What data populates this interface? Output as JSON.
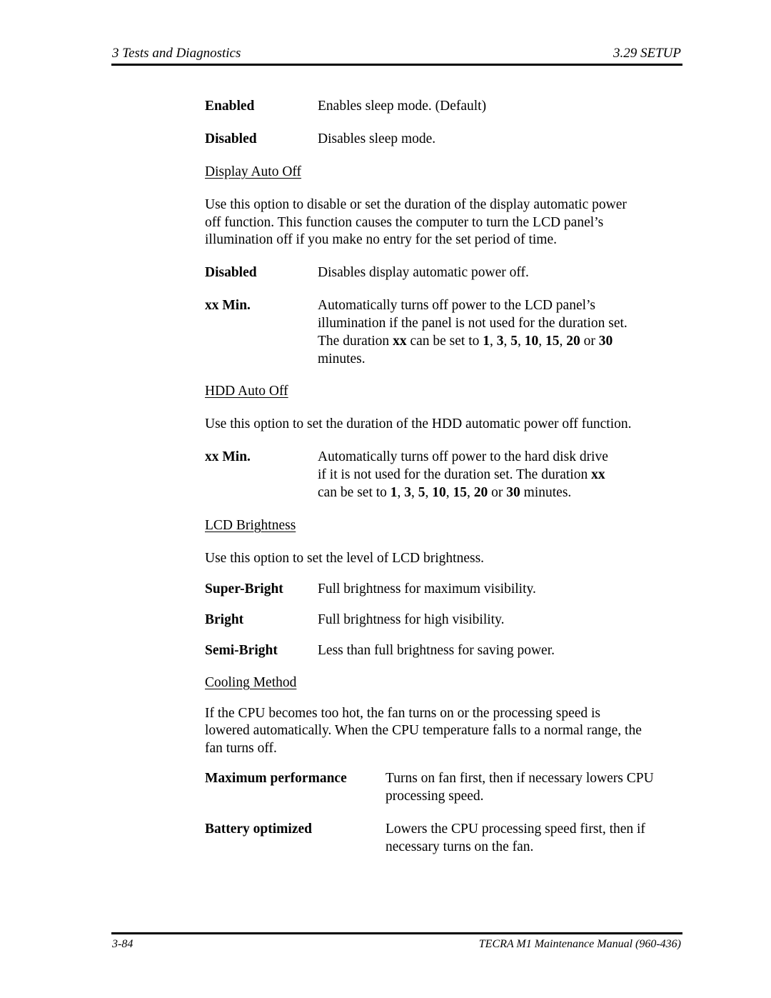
{
  "header": {
    "left": "3  Tests and Diagnostics",
    "right": "3.29  SETUP"
  },
  "sleep_options": [
    {
      "term": "Enabled",
      "desc": "Enables sleep mode. (Default)"
    },
    {
      "term": "Disabled",
      "desc": "Disables sleep mode."
    }
  ],
  "display_auto_off": {
    "heading": "Display Auto Off",
    "intro": [
      "Use this option to disable or set the duration of the display automatic power",
      "off function. This function causes the computer to turn the LCD panel’s",
      "illumination off if you make no entry for the set period of time."
    ],
    "disabled": {
      "term": "Disabled",
      "desc": "Disables display automatic power off."
    },
    "xxmin": {
      "term": "xx Min.",
      "lines": [
        "Automatically turns off power to the LCD panel’s",
        "illumination if the panel is not used for the duration set."
      ],
      "line3_prefix": "The duration ",
      "xx": "xx",
      "line3_mid": " can be set to ",
      "values": [
        "1",
        "3",
        "5",
        "10",
        "15",
        "20",
        "30"
      ],
      "or": " or ",
      "line4": "minutes."
    }
  },
  "hdd_auto_off": {
    "heading": "HDD Auto Off",
    "intro": "Use this option to set the duration of the HDD automatic power off function.",
    "xxmin": {
      "term": "xx Min.",
      "line1": "Automatically turns off power to the hard disk drive",
      "line2_prefix": "if it is not used for the duration set. The duration ",
      "xx": "xx",
      "line3_prefix": "can be set to ",
      "values": [
        "1",
        "3",
        "5",
        "10",
        "15",
        "20",
        "30"
      ],
      "or": " or ",
      "suffix": " minutes."
    }
  },
  "lcd_brightness": {
    "heading": "LCD Brightness",
    "intro": "Use this option to set the level of LCD brightness.",
    "options": [
      {
        "term": "Super-Bright",
        "desc": "Full brightness for maximum visibility."
      },
      {
        "term": "Bright",
        "desc": "Full brightness for high visibility."
      },
      {
        "term": "Semi-Bright",
        "desc": "Less than full brightness for saving power."
      }
    ]
  },
  "cooling_method": {
    "heading": "Cooling Method",
    "intro": [
      "If the CPU becomes too hot, the fan turns on or the processing speed is",
      "lowered automatically. When the CPU temperature falls to a normal range, the",
      "fan turns off."
    ],
    "options": [
      {
        "term": "Maximum performance",
        "lines": [
          "Turns on fan first, then if necessary lowers CPU",
          "processing speed."
        ]
      },
      {
        "term": "Battery optimized",
        "lines": [
          "Lowers the CPU processing speed first, then if",
          "necessary turns on the fan."
        ]
      }
    ]
  },
  "footer": {
    "left": "3-84",
    "right": "TECRA M1  Maintenance Manual (960-436)"
  }
}
